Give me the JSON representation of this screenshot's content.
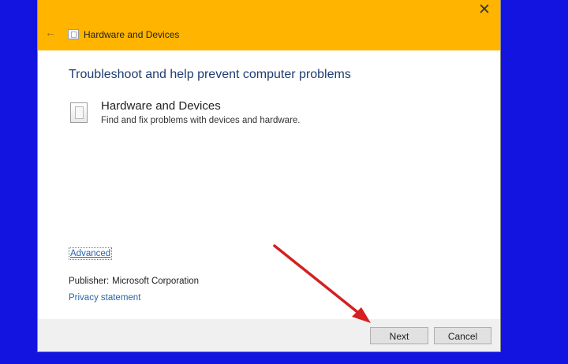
{
  "window": {
    "title": "Hardware and Devices",
    "close_glyph": "✕",
    "back_glyph": "←",
    "titlebar_color": "#ffb400"
  },
  "main": {
    "headline": "Troubleshoot and help prevent computer problems",
    "task": {
      "title": "Hardware and Devices",
      "description": "Find and fix problems with devices and hardware."
    },
    "advanced_link": "Advanced",
    "publisher_label": "Publisher:",
    "publisher_value": "Microsoft Corporation",
    "privacy_link": "Privacy statement"
  },
  "footer": {
    "next_label": "Next",
    "cancel_label": "Cancel"
  },
  "annotation": {
    "arrow_color": "#d42020",
    "points_to": "Next"
  },
  "background_color": "#1414e0"
}
